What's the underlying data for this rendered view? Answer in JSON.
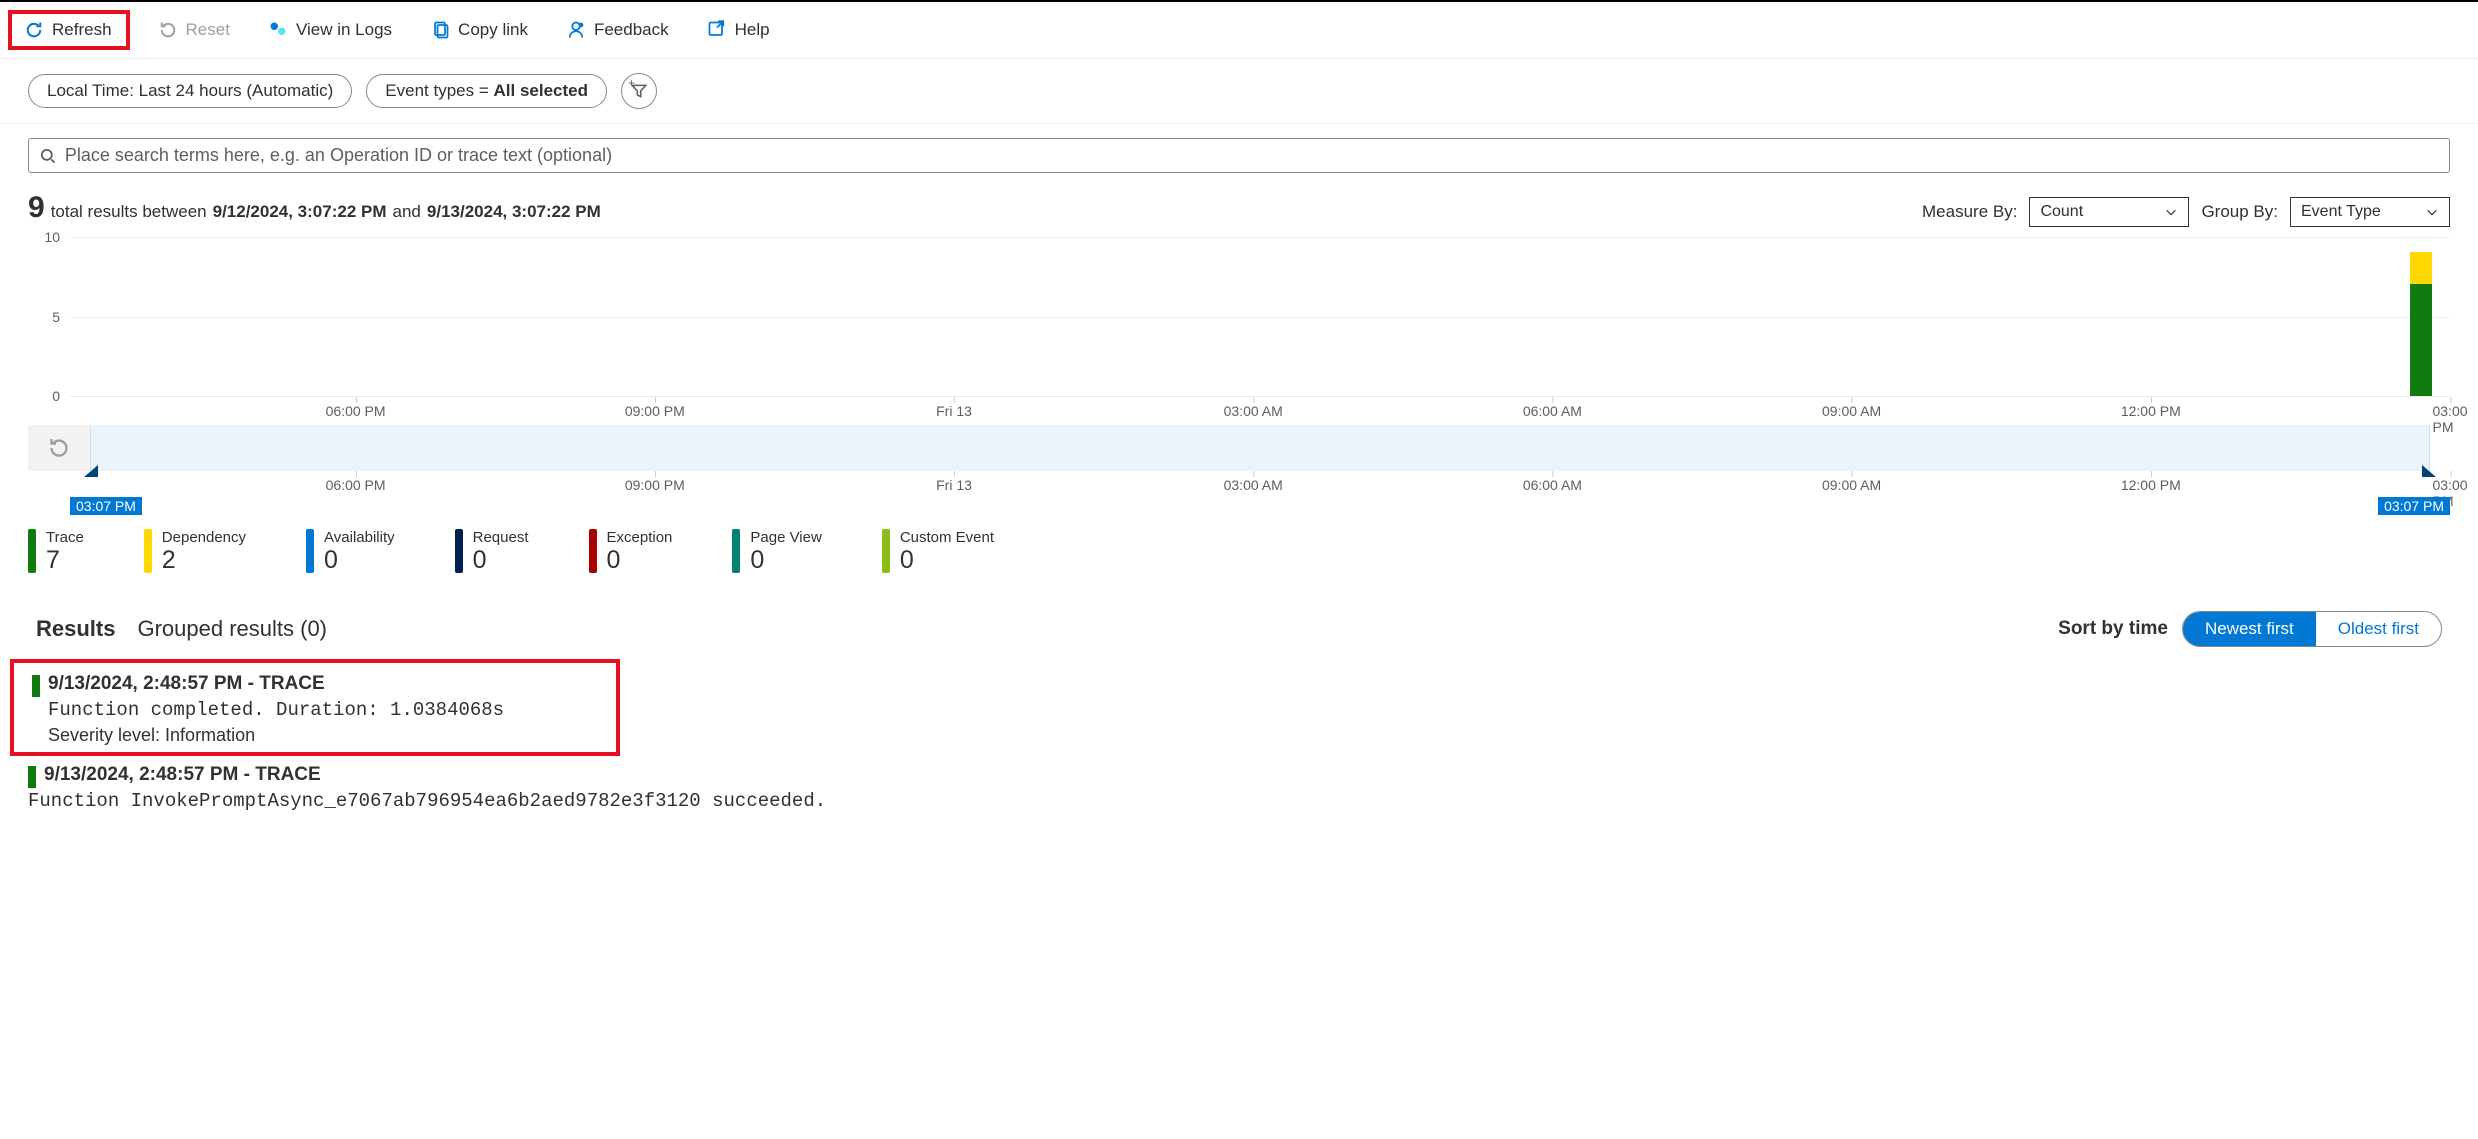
{
  "toolbar": {
    "refresh": "Refresh",
    "reset": "Reset",
    "view_in_logs": "View in Logs",
    "copy_link": "Copy link",
    "feedback": "Feedback",
    "help": "Help"
  },
  "filters": {
    "time_pill": "Local Time: Last 24 hours (Automatic)",
    "event_types_prefix": "Event types = ",
    "event_types_value": "All selected"
  },
  "search": {
    "placeholder": "Place search terms here, e.g. an Operation ID or trace text (optional)"
  },
  "summary": {
    "total": "9",
    "text1": "total results between",
    "from": "9/12/2024, 3:07:22 PM",
    "and": "and",
    "to": "9/13/2024, 3:07:22 PM"
  },
  "controls": {
    "measure_by_label": "Measure By:",
    "measure_by_value": "Count",
    "group_by_label": "Group By:",
    "group_by_value": "Event Type"
  },
  "chart_data": {
    "type": "bar",
    "y_ticks": [
      0,
      5,
      10
    ],
    "x_ticks": [
      "06:00 PM",
      "09:00 PM",
      "Fri 13",
      "03:00 AM",
      "06:00 AM",
      "09:00 AM",
      "12:00 PM",
      "03:00 PM"
    ],
    "bars": [
      {
        "position_pct": 98.3,
        "segments": {
          "trace": 7,
          "dependency": 2
        },
        "total": 9
      }
    ],
    "ymax": 10,
    "brush": {
      "start_label": "03:07 PM",
      "end_label": "03:07 PM"
    }
  },
  "legend": [
    {
      "label": "Trace",
      "value": "7",
      "color": "#107c10"
    },
    {
      "label": "Dependency",
      "value": "2",
      "color": "#ffd800"
    },
    {
      "label": "Availability",
      "value": "0",
      "color": "#0078d4"
    },
    {
      "label": "Request",
      "value": "0",
      "color": "#002050"
    },
    {
      "label": "Exception",
      "value": "0",
      "color": "#a80000"
    },
    {
      "label": "Page View",
      "value": "0",
      "color": "#008272"
    },
    {
      "label": "Custom Event",
      "value": "0",
      "color": "#8cbd18"
    }
  ],
  "results_tabs": {
    "results": "Results",
    "grouped": "Grouped results (0)"
  },
  "sort": {
    "label": "Sort by time",
    "newest": "Newest first",
    "oldest": "Oldest first"
  },
  "results": [
    {
      "header": "9/13/2024, 2:48:57 PM - TRACE",
      "body": "Function completed. Duration: 1.0384068s",
      "severity": "Severity level: Information"
    },
    {
      "header": "9/13/2024, 2:48:57 PM - TRACE",
      "body": "Function InvokePromptAsync_e7067ab796954ea6b2aed9782e3f3120 succeeded."
    }
  ]
}
